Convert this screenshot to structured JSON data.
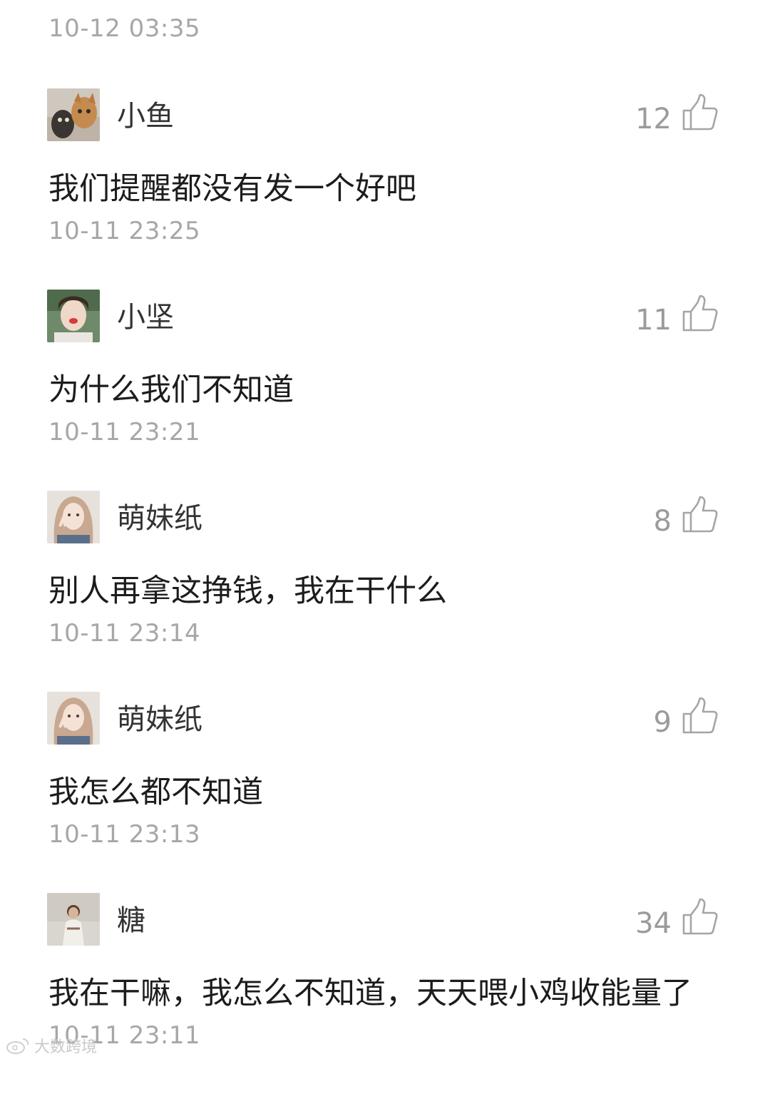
{
  "top_timestamp": "10-12 03:35",
  "comments": [
    {
      "username": "小鱼",
      "likes": "12",
      "text": "我们提醒都没有发一个好吧",
      "time": "10-11 23:25"
    },
    {
      "username": "小坚",
      "likes": "11",
      "text": "为什么我们不知道",
      "time": "10-11 23:21"
    },
    {
      "username": "萌妹纸",
      "likes": "8",
      "text": "别人再拿这挣钱，我在干什么",
      "time": "10-11 23:14"
    },
    {
      "username": "萌妹纸",
      "likes": "9",
      "text": "我怎么都不知道",
      "time": "10-11 23:13"
    },
    {
      "username": "糖",
      "likes": "34",
      "text": "我在干嘛，我怎么不知道，天天喂小鸡收能量了",
      "time": "10-11 23:11"
    }
  ],
  "watermark": "大数跨境",
  "colors": {
    "timestamp": "#a7a7a7",
    "username": "#333333",
    "likes": "#9b9b9b",
    "content": "#1c1c1c"
  },
  "icons": {
    "like": "thumbs-up-icon",
    "watermark": "weibo-logo-icon"
  }
}
